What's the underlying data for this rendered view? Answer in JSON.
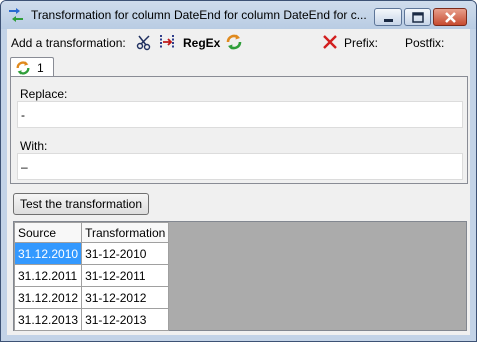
{
  "window": {
    "title": "Transformation for column DateEnd for column DateEnd for c..."
  },
  "toolbar": {
    "add_label": "Add a transformation:",
    "regex_label": "RegEx",
    "prefix_label": "Prefix:",
    "prefix_value": "",
    "postfix_label": "Postfix:",
    "postfix_value": ""
  },
  "tabs": [
    {
      "label": "1"
    }
  ],
  "form": {
    "replace_label": "Replace:",
    "replace_value": "-",
    "with_label": "With:",
    "with_value": "–"
  },
  "test_button_label": "Test the transformation",
  "grid": {
    "headers": [
      "Source",
      "Transformation"
    ],
    "rows": [
      {
        "source": "31.12.2010",
        "transformation": "31-12-2010"
      },
      {
        "source": "31.12.2011",
        "transformation": "31-12-2011"
      },
      {
        "source": "31.12.2012",
        "transformation": "31-12-2012"
      },
      {
        "source": "31.12.2013",
        "transformation": "31-12-2013"
      }
    ]
  },
  "colors": {
    "selection": "#3399ff",
    "grid_background": "#ababab",
    "close_button": "#c74b30"
  }
}
